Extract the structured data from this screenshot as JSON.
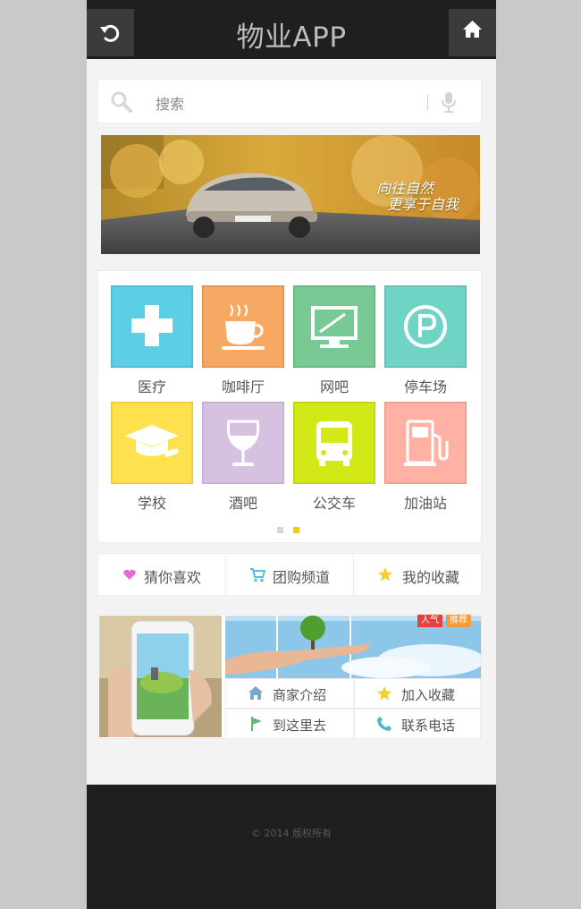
{
  "header": {
    "title": "物业APP",
    "back_icon": "refresh-icon",
    "home_icon": "home-icon"
  },
  "search": {
    "placeholder": "搜索",
    "search_icon": "search-icon",
    "mic_icon": "microphone-icon"
  },
  "banner": {
    "line1": "向往自然",
    "line2": "更享于自我"
  },
  "categories": [
    {
      "label": "医疗",
      "icon": "medical-cross-icon",
      "color": "#5ccfe6"
    },
    {
      "label": "咖啡厅",
      "icon": "coffee-cup-icon",
      "color": "#f7a862"
    },
    {
      "label": "网吧",
      "icon": "monitor-icon",
      "color": "#79c995"
    },
    {
      "label": "停车场",
      "icon": "parking-icon",
      "color": "#6fd4c6"
    },
    {
      "label": "学校",
      "icon": "graduation-cap-icon",
      "color": "#ffe04d"
    },
    {
      "label": "酒吧",
      "icon": "wine-glass-icon",
      "color": "#d6c2e0"
    },
    {
      "label": "公交车",
      "icon": "bus-icon",
      "color": "#d3e817"
    },
    {
      "label": "加油站",
      "icon": "fuel-pump-icon",
      "color": "#ffb1a4"
    }
  ],
  "pager": {
    "pages": 2,
    "active": 2
  },
  "quick_menu": [
    {
      "label": "猜你喜欢",
      "icon": "heart-icon",
      "color": "#e56bd2"
    },
    {
      "label": "团购频道",
      "icon": "cart-icon",
      "color": "#58bfe3"
    },
    {
      "label": "我的收藏",
      "icon": "star-icon",
      "color": "#f3cf2f"
    }
  ],
  "promo": {
    "badges": [
      "人气",
      "推荐"
    ],
    "actions": [
      {
        "label": "商家介绍",
        "icon": "home-icon",
        "color": "#7aa8c8"
      },
      {
        "label": "加入收藏",
        "icon": "star-icon",
        "color": "#f3cf2f"
      },
      {
        "label": "到这里去",
        "icon": "flag-icon",
        "color": "#66b37b"
      },
      {
        "label": "联系电话",
        "icon": "phone-icon",
        "color": "#4fb6d1"
      }
    ]
  },
  "footer": {
    "copyright": "© 2014 版权所有"
  }
}
